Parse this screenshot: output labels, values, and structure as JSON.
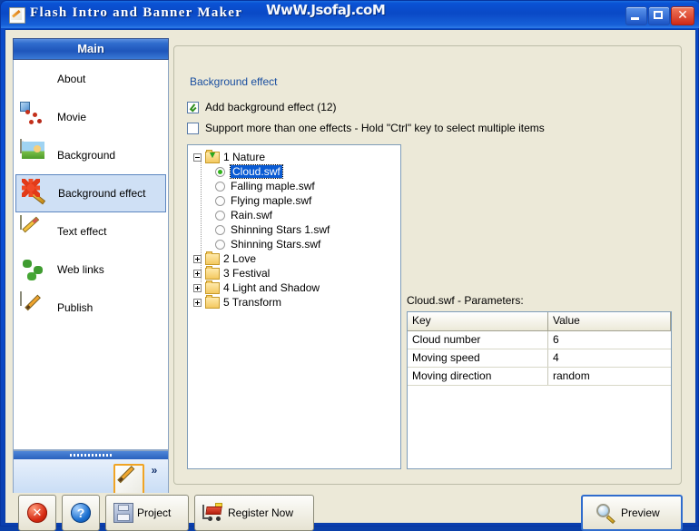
{
  "window": {
    "title": "Flash Intro and Banner Maker",
    "watermark": "WwW.JsofaJ.coM",
    "minimize_label": "Minimize",
    "maximize_label": "Maximize",
    "close_label": "Close"
  },
  "sidebar": {
    "header": "Main",
    "items": [
      {
        "label": "About",
        "icon": "home-icon",
        "selected": false
      },
      {
        "label": "Movie",
        "icon": "movie-icon",
        "selected": false
      },
      {
        "label": "Background",
        "icon": "picture-icon",
        "selected": false
      },
      {
        "label": "Background effect",
        "icon": "magic-wand-icon",
        "selected": true
      },
      {
        "label": "Text effect",
        "icon": "pencil-icon",
        "selected": false
      },
      {
        "label": "Web links",
        "icon": "globe-icon",
        "selected": false
      },
      {
        "label": "Publish",
        "icon": "paintbrush-page-icon",
        "selected": false
      }
    ],
    "footer": {
      "icon": "paintbrush-page-icon",
      "chevron": "»"
    }
  },
  "main": {
    "group_legend": "Background effect",
    "checkboxes": [
      {
        "label": "Add background effect (12)",
        "checked": true
      },
      {
        "label": "Support more than one effects - Hold \"Ctrl\" key to select multiple items",
        "checked": false
      }
    ],
    "tree": [
      {
        "type": "folder",
        "label": "1 Nature",
        "expanded": true,
        "expander": "minus"
      },
      {
        "type": "item",
        "label": "Cloud.swf",
        "selected": true
      },
      {
        "type": "item",
        "label": "Falling maple.swf",
        "selected": false
      },
      {
        "type": "item",
        "label": "Flying maple.swf",
        "selected": false
      },
      {
        "type": "item",
        "label": "Rain.swf",
        "selected": false
      },
      {
        "type": "item",
        "label": "Shinning Stars 1.swf",
        "selected": false
      },
      {
        "type": "item",
        "label": "Shinning Stars.swf",
        "selected": false
      },
      {
        "type": "folder",
        "label": "2 Love",
        "expanded": false,
        "expander": "plus"
      },
      {
        "type": "folder",
        "label": "3 Festival",
        "expanded": false,
        "expander": "plus"
      },
      {
        "type": "folder",
        "label": "4 Light and Shadow",
        "expanded": false,
        "expander": "plus"
      },
      {
        "type": "folder",
        "label": "5 Transform",
        "expanded": false,
        "expander": "plus"
      }
    ],
    "parameters": {
      "title": "Cloud.swf - Parameters:",
      "columns": [
        "Key",
        "Value"
      ],
      "rows": [
        {
          "key": "Cloud number",
          "value": "6"
        },
        {
          "key": "Moving speed",
          "value": "4"
        },
        {
          "key": "Moving direction",
          "value": "random"
        }
      ]
    }
  },
  "toolbar": {
    "cancel_label": "",
    "help_label": "",
    "project_label": "Project",
    "register_label": "Register Now",
    "preview_label": "Preview"
  },
  "colors": {
    "titlebar_blue": "#0a49c6",
    "selection_blue": "#0a5bd3",
    "sidebar_selected": "#cfe0f5",
    "client_bg": "#ece9d8",
    "legend_text": "#1a4fa0"
  }
}
